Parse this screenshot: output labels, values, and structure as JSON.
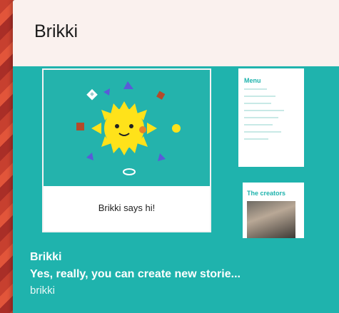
{
  "card": {
    "title": "Brikki",
    "preview_caption": "Brikki says hi!",
    "thumb_menu_heading": "Menu",
    "thumb_creators_heading": "The creators",
    "name": "Brikki",
    "description": "Yes, really, you can create new storie...",
    "author": "brikki"
  },
  "colors": {
    "teal": "#1fb3ad",
    "header": "#faf1ee",
    "sun": "#ffe21a"
  },
  "icons": [
    "sun-character-icon",
    "diamond-icon",
    "triangle-icon",
    "square-icon",
    "circle-icon",
    "ellipse-icon"
  ]
}
